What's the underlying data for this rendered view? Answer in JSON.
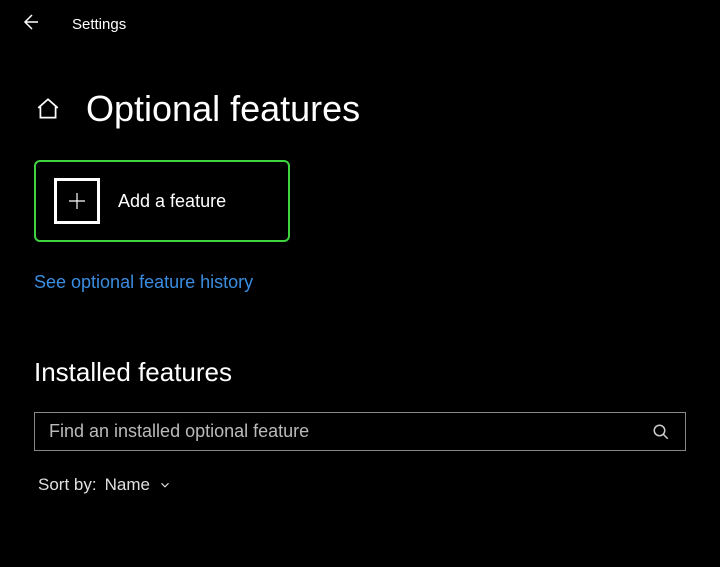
{
  "header": {
    "app_title": "Settings"
  },
  "page": {
    "title": "Optional features"
  },
  "add_feature": {
    "label": "Add a feature"
  },
  "history_link": {
    "label": "See optional feature history"
  },
  "installed": {
    "heading": "Installed features",
    "search_placeholder": "Find an installed optional feature"
  },
  "sort": {
    "label": "Sort by:",
    "value": "Name"
  },
  "icons": {
    "back": "back-arrow-icon",
    "home": "home-icon",
    "plus": "plus-icon",
    "search": "search-icon",
    "chevron": "chevron-down-icon"
  }
}
